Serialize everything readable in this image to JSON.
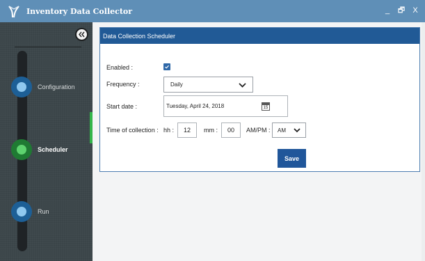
{
  "window": {
    "title": "Inventory Data Collector",
    "controls": [
      "_",
      "🗗",
      "X"
    ],
    "title_bar_color": "#5f8fb7"
  },
  "sidebar": {
    "collapse_icon": "double-chevron-left-icon",
    "steps": [
      {
        "label": "Configuration",
        "state": "done",
        "color": "#3b9ad9"
      },
      {
        "label": "Scheduler",
        "state": "active",
        "color": "#39b54a"
      },
      {
        "label": "Run",
        "state": "pending",
        "color": "#3b9ad9"
      }
    ]
  },
  "scheduler": {
    "title": "Data Collection Scheduler",
    "enabled_label": "Enabled :",
    "enabled": true,
    "frequency_label": "Frequency :",
    "frequency_value": "Daily",
    "start_date_label": "Start date :",
    "start_date_value": "Tuesday, April 24, 2018",
    "calendar_day": "15",
    "time_label": "Time of collection :",
    "hh_label": "hh :",
    "hh_value": "12",
    "mm_label": "mm :",
    "mm_value": "00",
    "ampm_label": "AM/PM :",
    "ampm_value": "AM",
    "save_label": "Save",
    "accent": "#215a96"
  }
}
